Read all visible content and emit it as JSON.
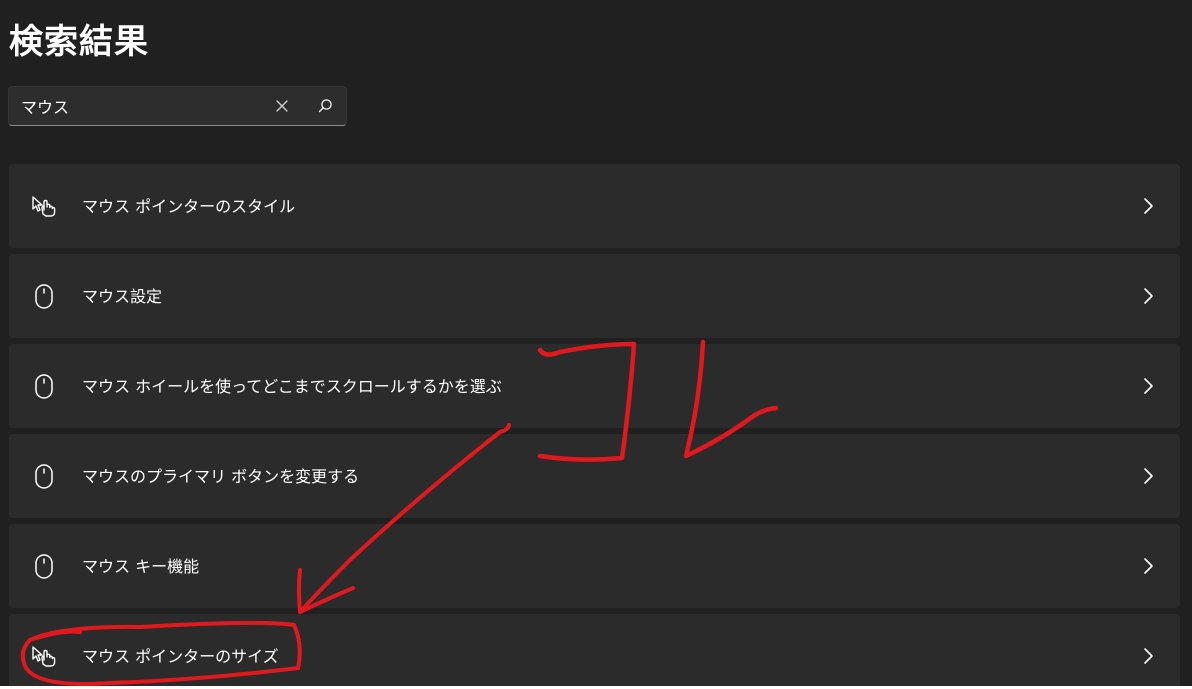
{
  "header": {
    "title": "検索結果"
  },
  "search": {
    "value": "マウス",
    "clear_icon": "close-icon",
    "search_icon": "search-icon"
  },
  "results": [
    {
      "label": "マウス ポインターのスタイル",
      "icon": "pointer-hand-icon"
    },
    {
      "label": "マウス設定",
      "icon": "mouse-icon"
    },
    {
      "label": "マウス ホイールを使ってどこまでスクロールするかを選ぶ",
      "icon": "mouse-icon"
    },
    {
      "label": "マウスのプライマリ ボタンを変更する",
      "icon": "mouse-icon"
    },
    {
      "label": "マウス キー機能",
      "icon": "mouse-icon"
    },
    {
      "label": "マウス ポインターのサイズ",
      "icon": "pointer-hand-icon"
    }
  ],
  "annotation": {
    "text": "コレ",
    "color": "#e0191e"
  },
  "colors": {
    "background": "#202020",
    "row": "#2b2b2b",
    "text": "#ffffff"
  }
}
